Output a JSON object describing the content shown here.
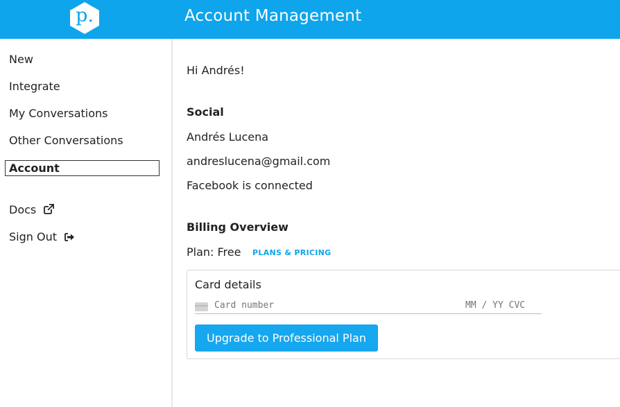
{
  "header": {
    "logo_letter": "p.",
    "title": "Account Management"
  },
  "sidebar": {
    "items": [
      {
        "label": "New"
      },
      {
        "label": "Integrate"
      },
      {
        "label": "My Conversations"
      },
      {
        "label": "Other Conversations"
      },
      {
        "label": "Account",
        "active": true
      },
      {
        "label": "Docs",
        "icon": "external-link-icon"
      },
      {
        "label": "Sign Out",
        "icon": "sign-out-icon"
      }
    ]
  },
  "main": {
    "greeting": "Hi Andrés!",
    "social": {
      "heading": "Social",
      "name": "Andrés Lucena",
      "email": "andreslucena@gmail.com",
      "facebook_status": "Facebook is connected"
    },
    "billing": {
      "heading": "Billing Overview",
      "plan": "Plan: Free",
      "plans_link": "PLANS & PRICING",
      "card": {
        "title": "Card details",
        "card_number_placeholder": "Card number",
        "expiry_cvc_placeholder": "MM / YY CVC",
        "card_icon": "credit-card-icon"
      },
      "upgrade_button": "Upgrade to Professional Plan"
    }
  },
  "colors": {
    "brand_blue": "#0ea5ec",
    "button_blue": "#16a7ef"
  }
}
